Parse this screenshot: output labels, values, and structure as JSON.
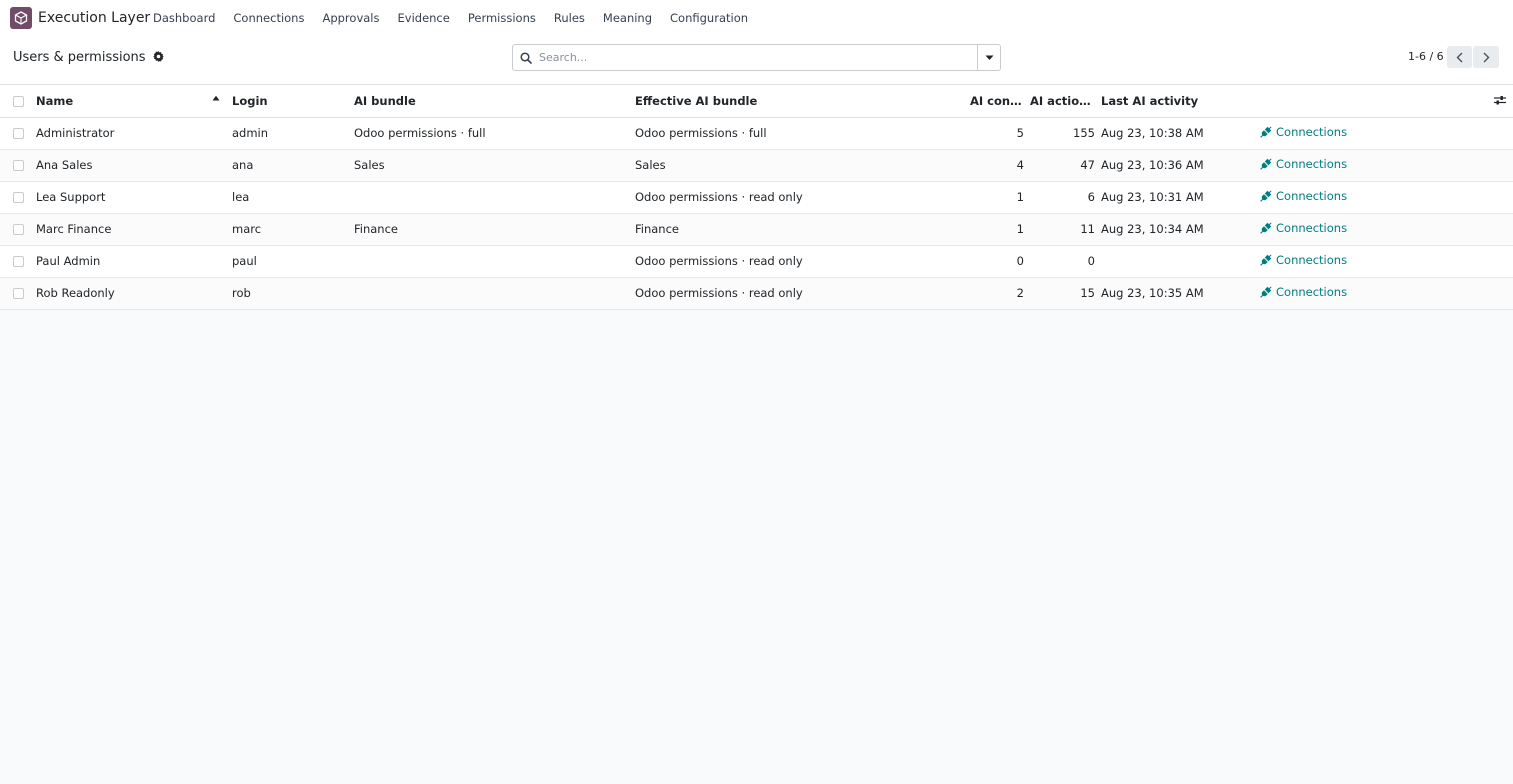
{
  "navbar": {
    "app_name": "Execution Layer",
    "menu": [
      "Dashboard",
      "Connections",
      "Approvals",
      "Evidence",
      "Permissions",
      "Rules",
      "Meaning",
      "Configuration"
    ]
  },
  "control_panel": {
    "title": "Users & permissions",
    "search_placeholder": "Search...",
    "pager_value": "1-6 / 6"
  },
  "table": {
    "columns": {
      "name": "Name",
      "login": "Login",
      "ai_bundle": "AI bundle",
      "effective_ai_bundle": "Effective AI bundle",
      "ai_connections": "AI conne…",
      "ai_actions": "AI action…",
      "last_ai_activity": "Last AI activity"
    },
    "sorted_by": "name",
    "rows": [
      {
        "name": "Administrator",
        "login": "admin",
        "ai_bundle": "Odoo permissions · full",
        "effective_ai_bundle": "Odoo permissions · full",
        "ai_connections": "5",
        "ai_actions": "155",
        "last_ai_activity": "Aug 23, 10:38 AM",
        "button": "Connections"
      },
      {
        "name": "Ana Sales",
        "login": "ana",
        "ai_bundle": "Sales",
        "effective_ai_bundle": "Sales",
        "ai_connections": "4",
        "ai_actions": "47",
        "last_ai_activity": "Aug 23, 10:36 AM",
        "button": "Connections"
      },
      {
        "name": "Lea Support",
        "login": "lea",
        "ai_bundle": "",
        "effective_ai_bundle": "Odoo permissions · read only",
        "ai_connections": "1",
        "ai_actions": "6",
        "last_ai_activity": "Aug 23, 10:31 AM",
        "button": "Connections"
      },
      {
        "name": "Marc Finance",
        "login": "marc",
        "ai_bundle": "Finance",
        "effective_ai_bundle": "Finance",
        "ai_connections": "1",
        "ai_actions": "11",
        "last_ai_activity": "Aug 23, 10:34 AM",
        "button": "Connections"
      },
      {
        "name": "Paul Admin",
        "login": "paul",
        "ai_bundle": "",
        "effective_ai_bundle": "Odoo permissions · read only",
        "ai_connections": "0",
        "ai_actions": "0",
        "last_ai_activity": "",
        "button": "Connections"
      },
      {
        "name": "Rob Readonly",
        "login": "rob",
        "ai_bundle": "",
        "effective_ai_bundle": "Odoo permissions · read only",
        "ai_connections": "2",
        "ai_actions": "15",
        "last_ai_activity": "Aug 23, 10:35 AM",
        "button": "Connections"
      }
    ]
  },
  "icons": {
    "app_logo": "cube-icon",
    "title_gear": "gear-icon",
    "search": "search-icon",
    "search_toggle": "caret-down-icon",
    "pager_prev": "chevron-left-icon",
    "pager_next": "chevron-right-icon",
    "sort": "sort-up-icon",
    "row_button": "plug-icon",
    "optional_columns": "sliders-icon"
  },
  "colors": {
    "brand": "#714b67",
    "link": "#017e84"
  }
}
